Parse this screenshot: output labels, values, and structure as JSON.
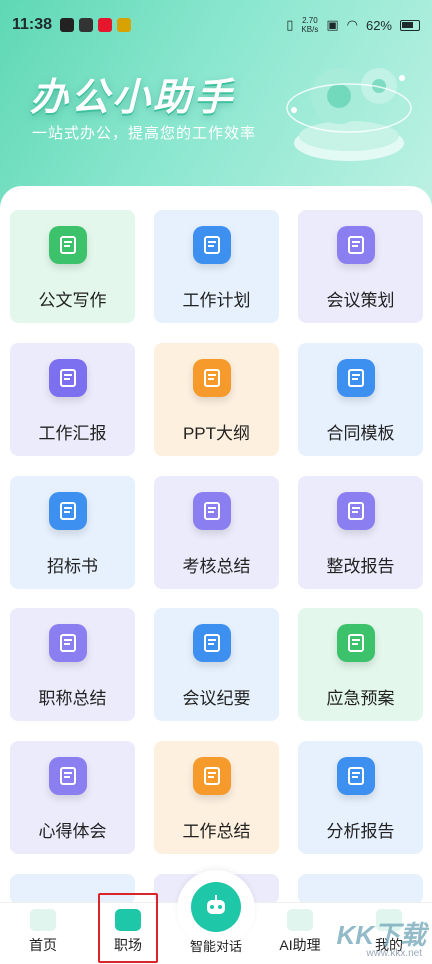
{
  "status_bar": {
    "time": "11:38",
    "speed_top": "2.70",
    "speed_bottom": "KB/s",
    "battery": "62%"
  },
  "header": {
    "title": "办公小助手",
    "subtitle": "一站式办公，提高您的工作效率"
  },
  "grid": [
    {
      "label": "公文写作",
      "icon": "document-list-icon",
      "bg": "#e3f7ec",
      "icon_color": "#3cc26a"
    },
    {
      "label": "工作计划",
      "icon": "clock-clipboard-icon",
      "bg": "#e6f1fd",
      "icon_color": "#3d8ff0"
    },
    {
      "label": "会议策划",
      "icon": "meeting-icon",
      "bg": "#ecebfb",
      "icon_color": "#8b7ef0"
    },
    {
      "label": "工作汇报",
      "icon": "trend-chart-icon",
      "bg": "#ecebfb",
      "icon_color": "#7c6ff0"
    },
    {
      "label": "PPT大纲",
      "icon": "ppt-icon",
      "bg": "#fdf0df",
      "icon_color": "#f59a2b"
    },
    {
      "label": "合同模板",
      "icon": "contract-star-icon",
      "bg": "#e6f1fd",
      "icon_color": "#3d8ff0"
    },
    {
      "label": "招标书",
      "icon": "bid-icon",
      "bg": "#e6f1fd",
      "icon_color": "#3d8ff0"
    },
    {
      "label": "考核总结",
      "icon": "edit-doc-icon",
      "bg": "#ecebfb",
      "icon_color": "#8b7ef0"
    },
    {
      "label": "整改报告",
      "icon": "tools-icon",
      "bg": "#ecebfb",
      "icon_color": "#8b7ef0"
    },
    {
      "label": "职称总结",
      "icon": "id-card-icon",
      "bg": "#ecebfb",
      "icon_color": "#8b7ef0"
    },
    {
      "label": "会议纪要",
      "icon": "minutes-icon",
      "bg": "#e6f1fd",
      "icon_color": "#3d8ff0"
    },
    {
      "label": "应急预案",
      "icon": "warning-doc-icon",
      "bg": "#e3f7ec",
      "icon_color": "#3cc26a"
    },
    {
      "label": "心得体会",
      "icon": "heart-card-icon",
      "bg": "#ecebfb",
      "icon_color": "#8b7ef0"
    },
    {
      "label": "工作总结",
      "icon": "checklist-icon",
      "bg": "#fdf0df",
      "icon_color": "#f59a2b"
    },
    {
      "label": "分析报告",
      "icon": "analysis-chart-icon",
      "bg": "#e6f1fd",
      "icon_color": "#3d8ff0"
    }
  ],
  "nav": {
    "home": "首页",
    "workplace": "职场",
    "chat": "智能对话",
    "ai_assistant": "AI助理",
    "mine": "我的"
  },
  "watermark": {
    "text": "KK下载",
    "url": "www.kkx.net"
  }
}
